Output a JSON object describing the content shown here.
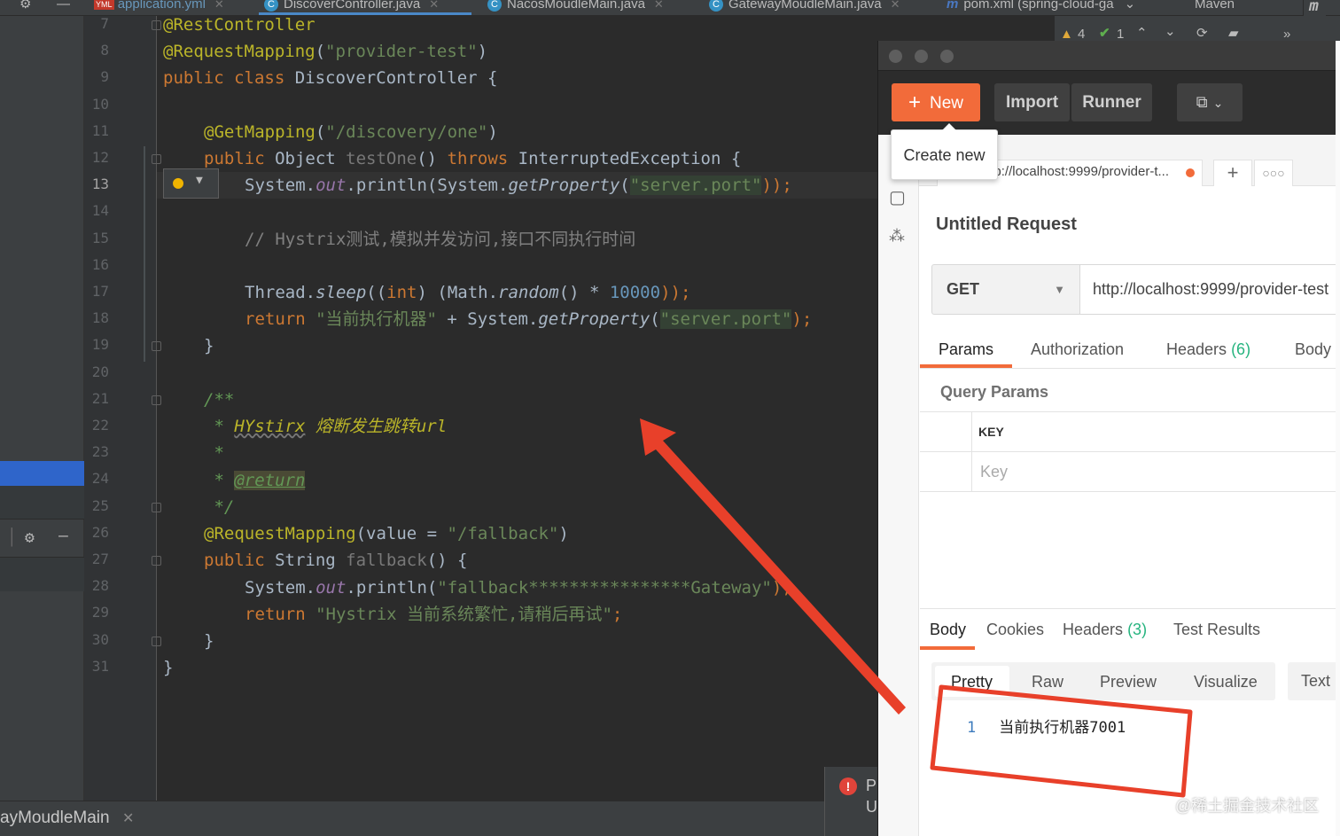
{
  "ide": {
    "tabs": [
      {
        "badge": "YML",
        "label": "application.yml"
      },
      {
        "label": "DiscoverController.java"
      },
      {
        "label": "NacosMoudleMain.java"
      },
      {
        "label": "GatewayMoudleMain.java"
      },
      {
        "label": "pom.xml (spring-cloud-ga"
      }
    ],
    "maven_label": "Maven",
    "warnings": "4",
    "ok_count": "1",
    "bottom_run_label": "ayMoudleMain",
    "notif_letters": [
      "P",
      "U"
    ],
    "line_numbers": [
      "7",
      "8",
      "9",
      "10",
      "11",
      "12",
      "13",
      "14",
      "15",
      "16",
      "17",
      "18",
      "19",
      "20",
      "21",
      "22",
      "23",
      "24",
      "25",
      "26",
      "27",
      "28",
      "29",
      "30",
      "31"
    ],
    "current_line": "13",
    "code": {
      "l7": "@RestController",
      "l8_ann": "@RequestMapping",
      "l8_str": "\"provider-test\"",
      "l9_kw": "public class ",
      "l9_name": "DiscoverController {",
      "l11_ann": "@GetMapping",
      "l11_str": "\"/discovery/one\"",
      "l12_kw1": "public ",
      "l12_type": "Object ",
      "l12_m": "testOne",
      "l12_kw2": "throws ",
      "l12_ex": "InterruptedException {",
      "l13_a": "System.",
      "l13_out": "out",
      "l13_b": ".println(System.",
      "l13_gp": "getProperty",
      "l13_str": "\"server.port\"",
      "l13_end": "));",
      "l15_cm": "// Hystrix测试,模拟并发访问,接口不同执行时间",
      "l17_a": "Thread.",
      "l17_sleep": "sleep",
      "l17_b": "((",
      "l17_int": "int",
      "l17_c": ") (Math.",
      "l17_rand": "random",
      "l17_d": "() * ",
      "l17_num": "10000",
      "l17_end": "));",
      "l18_ret": "return ",
      "l18_str": "\"当前执行机器\"",
      "l18_b": " + System.",
      "l18_gp": "getProperty",
      "l18_str2": "\"server.port\"",
      "l18_end": ");",
      "l19": "}",
      "l21": "/**",
      "l22_a": " * ",
      "l22_h": "HYstirx",
      "l22_b": " 熔断发生跳转url",
      "l23": " *",
      "l24_a": " * ",
      "l24_tag": "@return",
      "l25": " */",
      "l26_ann": "@RequestMapping",
      "l26_a": "(value = ",
      "l26_str": "\"/fallback\"",
      "l26_end": ")",
      "l27_kw": "public ",
      "l27_type": "String ",
      "l27_m": "fallback",
      "l27_end": "() {",
      "l28_a": "System.",
      "l28_out": "out",
      "l28_b": ".println(",
      "l28_str": "\"fallback****************Gateway\"",
      "l28_end": ");",
      "l29_ret": "return ",
      "l29_str": "\"Hystrix 当前系统繁忙,请稍后再试\"",
      "l29_end": ";",
      "l30": "}",
      "l31": "}"
    }
  },
  "postman": {
    "new_label": "New",
    "import_label": "Import",
    "runner_label": "Runner",
    "tooltip": "Create new",
    "tab_url": "GET http://localhost:9999/provider-t...",
    "request_name": "Untitled Request",
    "method": "GET",
    "url": "http://localhost:9999/provider-test",
    "req_tabs": {
      "params": "Params",
      "authorization": "Authorization",
      "headers": "Headers",
      "headers_count": "(6)",
      "body": "Body"
    },
    "query_params": "Query Params",
    "key_header": "KEY",
    "key_placeholder": "Key",
    "resp_tabs": {
      "body": "Body",
      "cookies": "Cookies",
      "headers": "Headers",
      "headers_count": "(3)",
      "tests": "Test Results"
    },
    "formats": [
      "Pretty",
      "Raw",
      "Preview",
      "Visualize"
    ],
    "format_type": "Text",
    "response": {
      "line": "1",
      "text": "当前执行机器7001"
    }
  },
  "watermark": "@稀土掘金技术社区",
  "colors": {
    "annotation_arrow": "#e8402a",
    "new_button": "#f26b3a",
    "ide_bg": "#2b2b2b"
  }
}
